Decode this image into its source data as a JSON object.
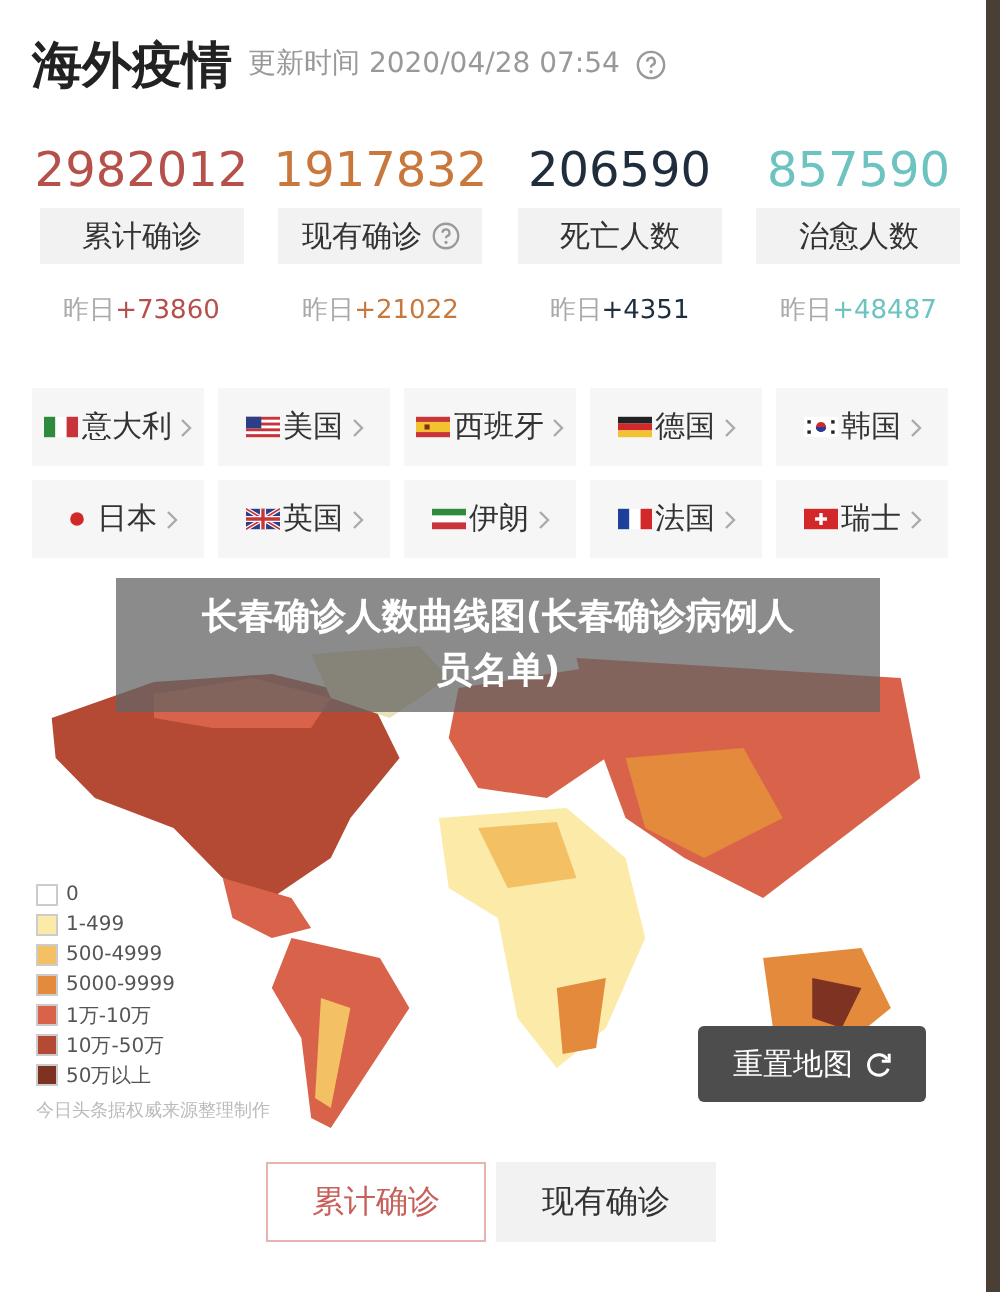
{
  "header": {
    "title": "海外疫情",
    "updated": "更新时间 2020/04/28 07:54",
    "help": true
  },
  "stats": [
    {
      "value": "2982012",
      "label": "累计确诊",
      "help": false,
      "yesterday_label": "昨日",
      "yesterday": "+73860",
      "color": "#b5504a"
    },
    {
      "value": "1917832",
      "label": "现有确诊",
      "help": true,
      "yesterday_label": "昨日",
      "yesterday": "+21022",
      "color": "#c8783c"
    },
    {
      "value": "206590",
      "label": "死亡人数",
      "help": false,
      "yesterday_label": "昨日",
      "yesterday": "+4351",
      "color": "#1f2d3d"
    },
    {
      "value": "857590",
      "label": "治愈人数",
      "help": false,
      "yesterday_label": "昨日",
      "yesterday": "+48487",
      "color": "#6cc3c0"
    }
  ],
  "countries": [
    {
      "name": "意大利"
    },
    {
      "name": "美国"
    },
    {
      "name": "西班牙"
    },
    {
      "name": "德国"
    },
    {
      "name": "韩国"
    },
    {
      "name": "日本"
    },
    {
      "name": "英国"
    },
    {
      "name": "伊朗"
    },
    {
      "name": "法国"
    },
    {
      "name": "瑞士"
    }
  ],
  "caption": "长春确诊人数曲线图(长春确诊病例人员名单)",
  "map": {
    "kind": "picture",
    "legend": [
      {
        "label": "0",
        "color": "#ffffff"
      },
      {
        "label": "1-499",
        "color": "#fbeaa8"
      },
      {
        "label": "500-4999",
        "color": "#f3c064"
      },
      {
        "label": "5000-9999",
        "color": "#e38a3c"
      },
      {
        "label": "1万-10万",
        "color": "#d9634a"
      },
      {
        "label": "10万-50万",
        "color": "#b44a34"
      },
      {
        "label": "50万以上",
        "color": "#7e3222"
      }
    ],
    "source": "今日头条据权威来源整理制作",
    "reset_button": "重置地图"
  },
  "tabs": [
    {
      "label": "累计确诊",
      "selected": true
    },
    {
      "label": "现有确诊",
      "selected": false
    }
  ]
}
